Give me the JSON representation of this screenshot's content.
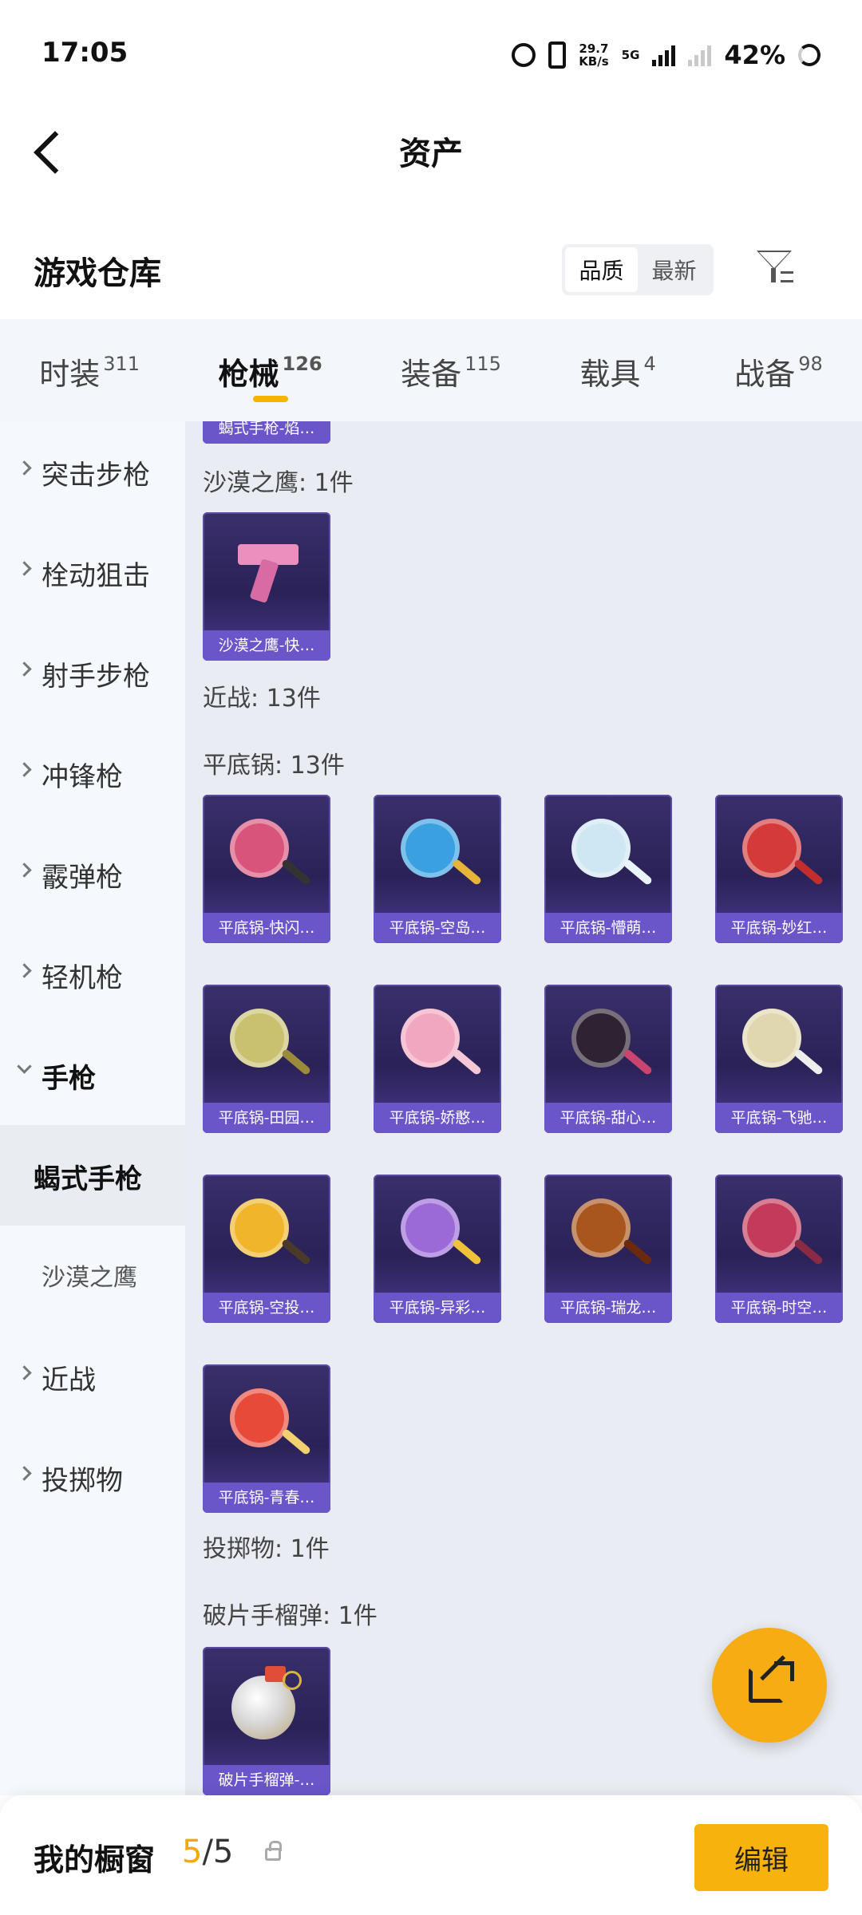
{
  "status_bar": {
    "time": "17:05",
    "net_speed_value": "29.7",
    "net_speed_unit": "KB/s",
    "network_type": "5G",
    "battery": "42%"
  },
  "header": {
    "title": "资产",
    "back_icon": "chevron-left-icon"
  },
  "section": {
    "title": "游戏仓库",
    "sort_options": [
      "品质",
      "最新"
    ],
    "sort_selected": "品质",
    "filter_icon": "filter-icon"
  },
  "tabs": [
    {
      "label": "时装",
      "count": "311"
    },
    {
      "label": "枪械",
      "count": "126",
      "active": true
    },
    {
      "label": "装备",
      "count": "115"
    },
    {
      "label": "载具",
      "count": "4"
    },
    {
      "label": "战备",
      "count": "98"
    }
  ],
  "sidebar": {
    "items": [
      {
        "label": "突击步枪"
      },
      {
        "label": "栓动狙击"
      },
      {
        "label": "射手步枪"
      },
      {
        "label": "冲锋枪"
      },
      {
        "label": "霰弹枪"
      },
      {
        "label": "轻机枪"
      },
      {
        "label": "手枪",
        "expanded": true
      },
      {
        "label": "近战"
      },
      {
        "label": "投掷物"
      }
    ],
    "sub_items": [
      {
        "label": "蝎式手枪",
        "active": true
      },
      {
        "label": "沙漠之鹰"
      }
    ]
  },
  "content": {
    "partial_card_caption": "蝎式手枪-焰…",
    "groups": {
      "deagle_label": "沙漠之鹰: 1件",
      "melee_label": "近战: 13件",
      "pan_label": "平底锅: 13件",
      "throw_label": "投掷物: 1件",
      "frag_label": "破片手榴弹: 1件"
    },
    "deagle_cards": [
      "沙漠之鹰-快…"
    ],
    "pan_cards": [
      "平底锅-快闪…",
      "平底锅-空岛…",
      "平底锅-懵萌…",
      "平底锅-妙红…",
      "平底锅-田园…",
      "平底锅-娇憨…",
      "平底锅-甜心…",
      "平底锅-飞驰…",
      "平底锅-空投…",
      "平底锅-异彩…",
      "平底锅-瑞龙…",
      "平底锅-时空…",
      "平底锅-青春…"
    ],
    "frag_cards": [
      "破片手榴弹-…"
    ]
  },
  "fab": {
    "icon": "share-external-icon"
  },
  "bottom_bar": {
    "label": "我的橱窗",
    "count_current": "5",
    "count_total": "/5",
    "lock_icon": "lock-icon",
    "edit_label": "编辑"
  },
  "colors": {
    "accent": "#f7b30c",
    "card_caption": "#6a55c9",
    "card_bg": "#2a2257"
  }
}
